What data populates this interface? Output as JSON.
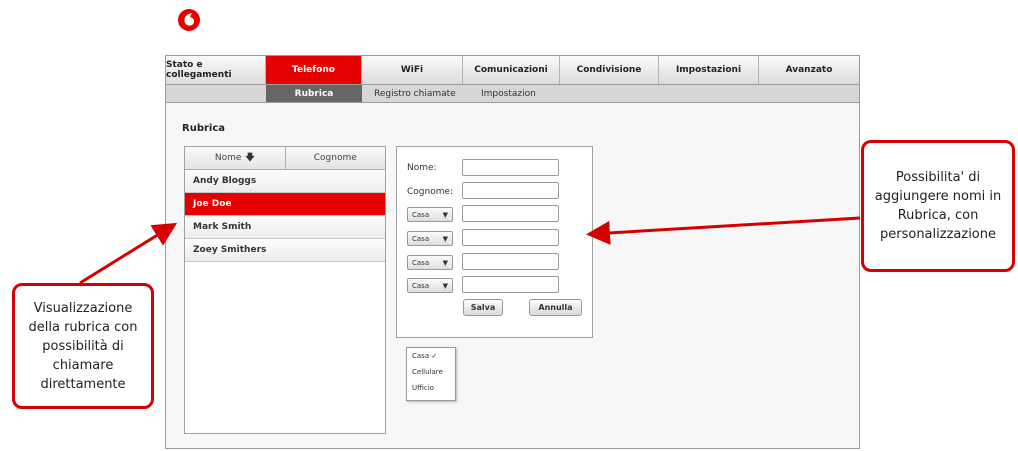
{
  "brand": {
    "logo_icon": "vodafone-logo-icon",
    "color": "#e60000"
  },
  "topnav": {
    "tabs": [
      {
        "label": "Stato e collegamenti"
      },
      {
        "label": "Telefono"
      },
      {
        "label": "WiFi"
      },
      {
        "label": "Comunicazioni"
      },
      {
        "label": "Condivisione"
      },
      {
        "label": "Impostazioni"
      },
      {
        "label": "Avanzato"
      }
    ],
    "active": "Telefono"
  },
  "subnav": {
    "items": [
      {
        "label": "Rubrica"
      },
      {
        "label": "Registro chiamate"
      },
      {
        "label": "Impostazion"
      }
    ],
    "active": "Rubrica"
  },
  "page": {
    "title": "Rubrica"
  },
  "list": {
    "sort_name": "Nome",
    "sort_name_icon": "arrow-down-icon",
    "sort_surname": "Cognome",
    "contacts": [
      {
        "name": "Andy Bloggs"
      },
      {
        "name": "Joe Doe"
      },
      {
        "name": "Mark Smith"
      },
      {
        "name": "Zoey Smithers"
      }
    ],
    "selected": "Joe Doe"
  },
  "form": {
    "name_label": "Nome:",
    "surname_label": "Cognome:",
    "name_value": "",
    "surname_value": "",
    "phone_types": [
      "Casa",
      "Casa",
      "Casa",
      "Casa"
    ],
    "save_label": "Salva",
    "cancel_label": "Annulla",
    "dropdown_options": [
      "Casa",
      "Cellulare",
      "Ufficio"
    ],
    "dropdown_selected": "Casa"
  },
  "annotations": {
    "right": "Possibilita' di aggiungere nomi in Rubrica, con personalizzazione",
    "left": "Visualizzazione della rubrica con possibilità di chiamare direttamente",
    "color": "#d50000"
  }
}
